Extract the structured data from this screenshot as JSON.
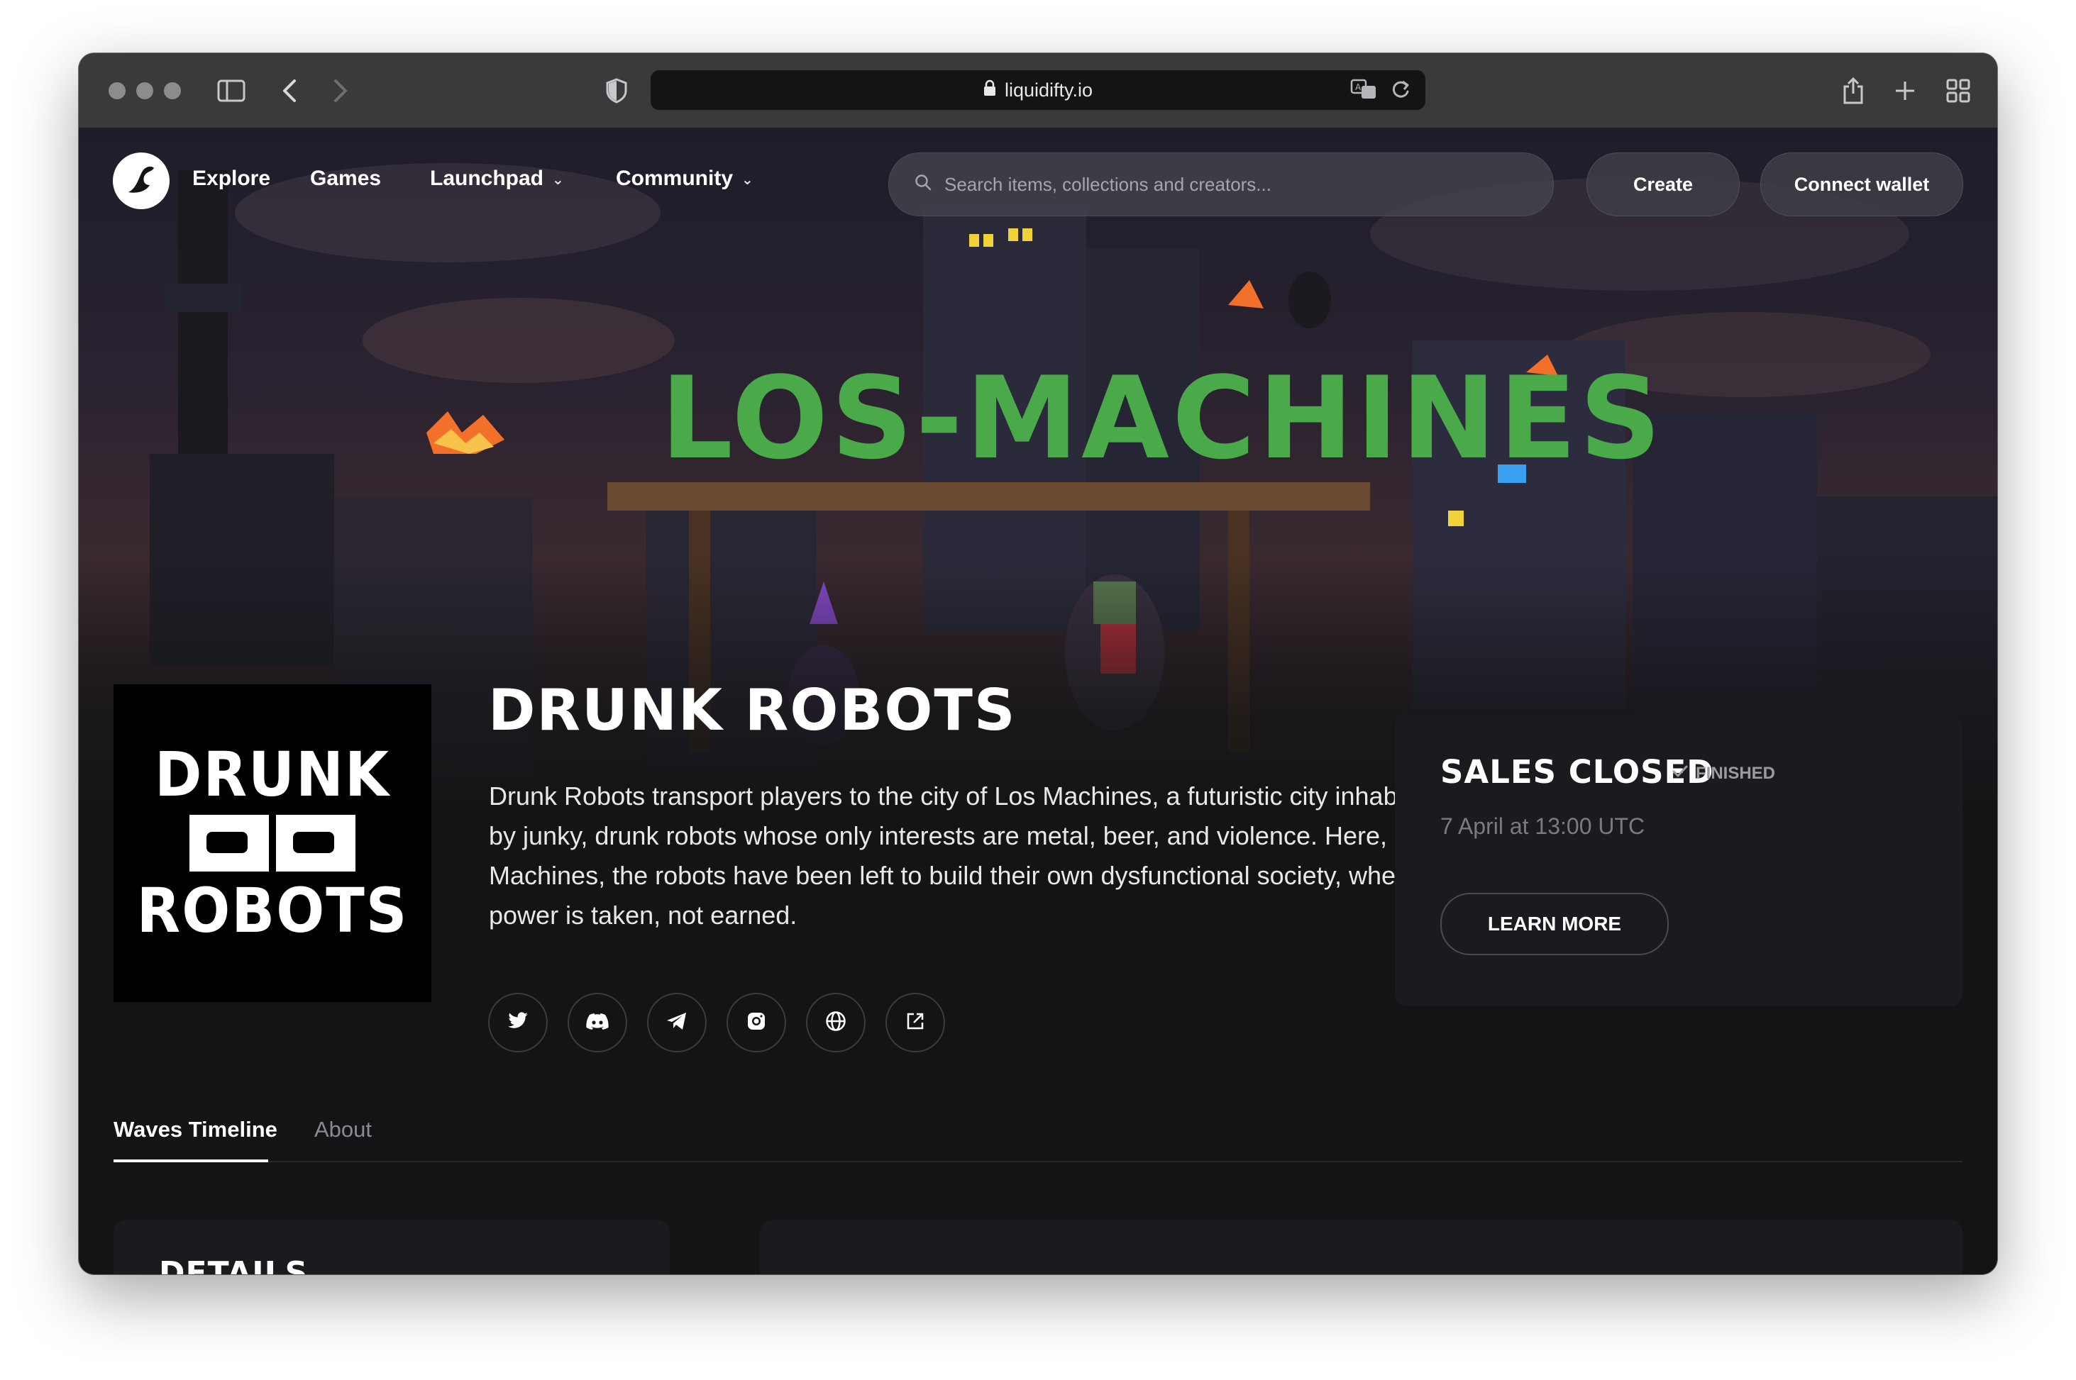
{
  "browser": {
    "url": "liquidifty.io"
  },
  "nav": {
    "links": [
      {
        "label": "Explore"
      },
      {
        "label": "Games"
      },
      {
        "label": "Launchpad",
        "has_dropdown": true
      },
      {
        "label": "Community",
        "has_dropdown": true
      }
    ],
    "search_placeholder": "Search items, collections and creators...",
    "create_label": "Create",
    "connect_label": "Connect wallet"
  },
  "hero": {
    "sign_text": "LOS-MACHINES"
  },
  "collection": {
    "logo_text_top": "DRUNK",
    "logo_text_bottom": "ROBOTS",
    "title": "DRUNK ROBOTS",
    "description": "Drunk Robots transport players to the city of Los Machines, a futuristic city inhabited by junky, drunk robots whose only interests are metal, beer, and violence. Here, in Los Machines, the robots have been left to build their own dysfunctional society, where power is taken, not earned.",
    "socials": [
      "twitter-icon",
      "discord-icon",
      "telegram-icon",
      "instagram-icon",
      "globe-icon",
      "external-link-icon"
    ]
  },
  "sales": {
    "title": "SALES CLOSED",
    "status": "FINISHED",
    "date": "7 April at 13:00 UTC",
    "button": "LEARN MORE"
  },
  "tabs": [
    {
      "label": "Waves Timeline",
      "active": true
    },
    {
      "label": "About",
      "active": false
    }
  ],
  "details": {
    "title": "DETAILS"
  }
}
